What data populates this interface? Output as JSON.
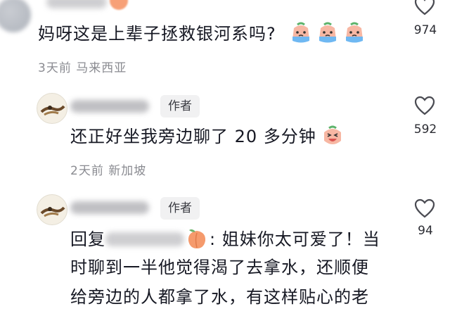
{
  "comments": [
    {
      "text": "妈呀这是上辈子拯救银河系吗?",
      "meta": "3天前 马来西亚",
      "likes": "974",
      "emoji": "crying-emoji"
    },
    {
      "author_badge": "作者",
      "text": "还正好坐我旁边聊了 20 多分钟",
      "meta": "2天前 新加坡",
      "likes": "592",
      "emoji": "laughing-emoji"
    },
    {
      "author_badge": "作者",
      "reply_prefix": "回复",
      "reply_colon": ": 姐妹你太可爱了！当",
      "line2": "时聊到一半他觉得渴了去拿水，还顺便",
      "line3": "给旁边的人都拿了水，有这样贴心的老",
      "likes": "94",
      "emoji": "peach-emoji"
    }
  ],
  "colors": {
    "text": "#161823",
    "meta": "#8a8b91",
    "badge_bg": "#f1f1f2"
  }
}
